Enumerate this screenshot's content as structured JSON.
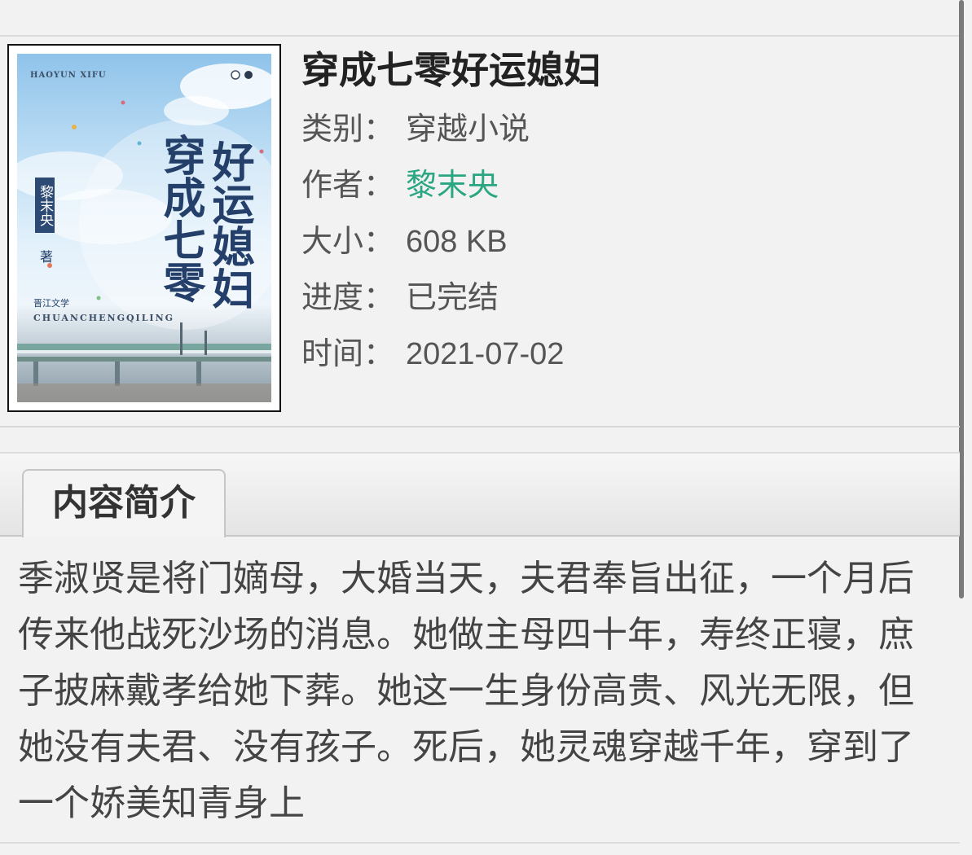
{
  "book": {
    "title": "穿成七零好运媳妇",
    "cover": {
      "pinyin_top": "HAOYUN XIFU",
      "title_col_a": "穿成七零",
      "title_col_b": "好运媳妇",
      "author_tag": "黎末央",
      "zhu": "著",
      "publisher": "晋江文学",
      "pinyin_bottom": "CHUANCHENGQILING"
    },
    "meta": {
      "category_label": "类别：",
      "category_value": "穿越小说",
      "author_label": "作者：",
      "author_value": "黎末央",
      "size_label": "大小：",
      "size_value": "608 KB",
      "progress_label": "进度：",
      "progress_value": "已完结",
      "time_label": "时间：",
      "time_value": "2021-07-02"
    }
  },
  "tabs": {
    "intro_label": "内容简介"
  },
  "summary": {
    "text": "季淑贤是将门嫡母，大婚当天，夫君奉旨出征，一个月后传来他战死沙场的消息。她做主母四十年，寿终正寝，庶子披麻戴孝给她下葬。她这一生身份高贵、风光无限，但她没有夫君、没有孩子。死后，她灵魂穿越千年，穿到了一个娇美知青身上"
  },
  "colors": {
    "background": "#f2f2f2",
    "author_link": "#2aa682",
    "title_text": "#222222",
    "meta_text": "#555555"
  }
}
